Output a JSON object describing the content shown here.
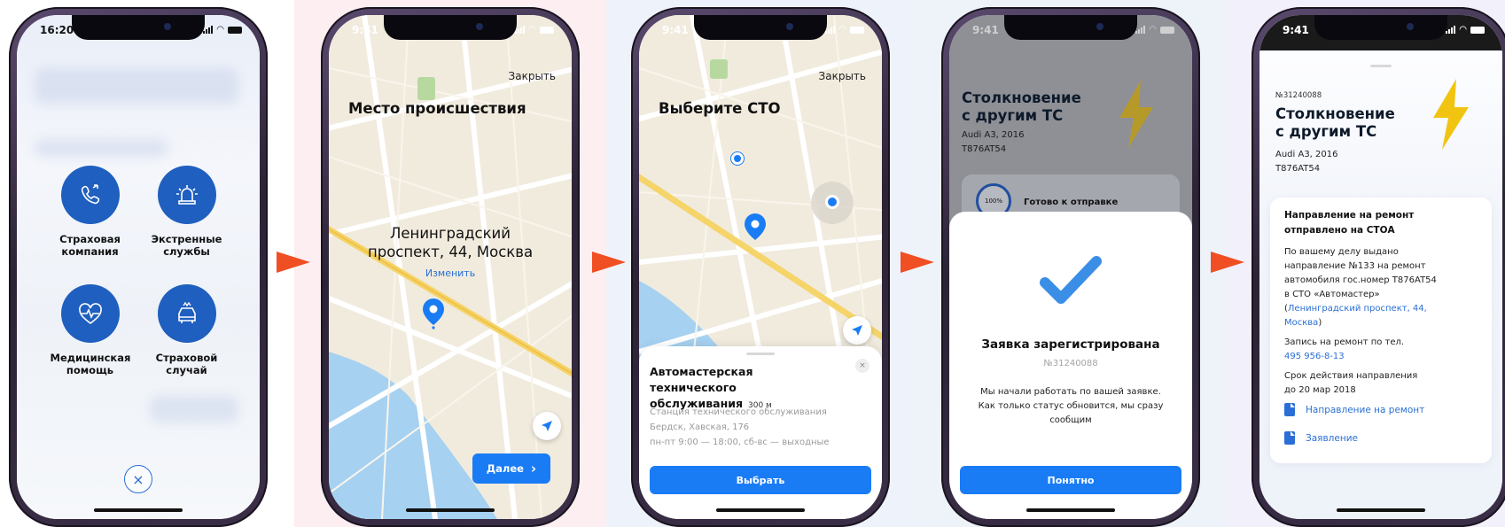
{
  "colors": {
    "accent": "#1a7cf5",
    "brand_blue": "#1f5fbf",
    "arrow": "#f04e23",
    "link": "#2b6fd6",
    "lightning": "#f2c412"
  },
  "screen1": {
    "time": "16:20",
    "services": [
      {
        "label": "Страховая компания",
        "icon": "phone-icon"
      },
      {
        "label": "Экстренные службы",
        "icon": "siren-icon"
      },
      {
        "label": "Медицинская помощь",
        "icon": "heart-pulse-icon"
      },
      {
        "label": "Страховой случай",
        "icon": "car-crash-icon"
      }
    ],
    "close_icon": "×"
  },
  "screen2": {
    "time": "9:41",
    "close_label": "Закрыть",
    "title": "Место происшествия",
    "address_line1": "Ленинградский",
    "address_line2": "проспект, 44, Москва",
    "change_label": "Изменить",
    "next_label": "Далее",
    "next_icon": "›"
  },
  "screen3": {
    "time": "9:41",
    "close_label": "Закрыть",
    "title": "Выберите СТО",
    "station_name": "Автомастерская технического обслуживания",
    "distance": "300 м",
    "station_type": "Станция технического обслуживания",
    "station_address": "Бердск, Хавская, 176",
    "station_hours": "пн-пт 9:00 — 18:00, сб-вс — выходные",
    "dismiss_icon": "×",
    "select_label": "Выбрать"
  },
  "screen4": {
    "time": "9:41",
    "title_line1": "Столкновение",
    "title_line2": "с другим ТС",
    "car_model": "Audi A3, 2016",
    "car_plate": "T876AT54",
    "progress_label": "100%",
    "progress_value": 1.0,
    "progress_status": "Готово к отправке",
    "modal_title": "Заявка зарегистрирована",
    "claim_number": "№31240088",
    "modal_line1": "Мы начали работать по вашей заявке.",
    "modal_line2": "Как только статус обновится, мы сразу",
    "modal_line3": "сообщим",
    "ok_label": "Понятно"
  },
  "screen5": {
    "time": "9:41",
    "claim_number": "№31240088",
    "title_line1": "Столкновение",
    "title_line2": "с другим ТС",
    "car_model": "Audi A3, 2016",
    "car_plate": "T876AT54",
    "card_title_line1": "Направление на ремонт",
    "card_title_line2": "отправлено на СТОА",
    "body_line1": "По вашему делу выдано",
    "body_line2": "направление №133 на ремонт",
    "body_line3": "автомобиля гос.номер T876AT54",
    "body_line4": "в СТО «Автомастер»",
    "body_paren_open": "(",
    "body_link1": "Ленинградский проспект, 44,",
    "body_link2": "Москва",
    "body_paren_close": ")",
    "phone_label": "Запись на ремонт по тел.",
    "phone_number": "495 956-8-13",
    "validity_line1": "Срок действия направления",
    "validity_line2": "до 20 мар 2018",
    "doc1": "Направление на ремонт",
    "doc2": "Заявление"
  }
}
